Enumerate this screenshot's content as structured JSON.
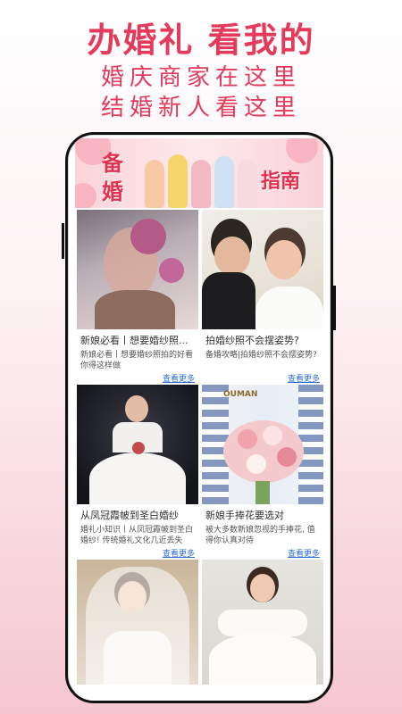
{
  "promo": {
    "headline": "办婚礼 看我的",
    "line1": "婚庆商家在这里",
    "line2": "结婚新人看这里"
  },
  "banner": {
    "word1": "备",
    "word2": "婚",
    "word3": "指南"
  },
  "cards": [
    {
      "title": "新娘必看丨想要婚纱照...",
      "desc": "新娘必看丨想要婚纱照拍的好看你得这样做",
      "more": "查看更多"
    },
    {
      "title": "拍婚纱照不会摆姿势?",
      "desc": "备婚攻略|拍婚纱照不会摆姿势?",
      "more": "查看更多"
    },
    {
      "title": "从凤冠霞帔到圣白婚纱",
      "desc": "婚礼小知识丨从凤冠霞帔到圣白婚纱! 传统婚礼文化几近丢失",
      "more": "查看更多"
    },
    {
      "title": "新娘手捧花要选对",
      "desc": "被大多数新娘忽视的手捧花, 值得你认真对待",
      "more": "查看更多"
    },
    {
      "title": "",
      "desc": "",
      "more": ""
    },
    {
      "title": "",
      "desc": "",
      "more": ""
    }
  ],
  "logo_text": "OUMAN",
  "colors": {
    "accent": "#e43a5c",
    "link": "#2f6fd3"
  }
}
